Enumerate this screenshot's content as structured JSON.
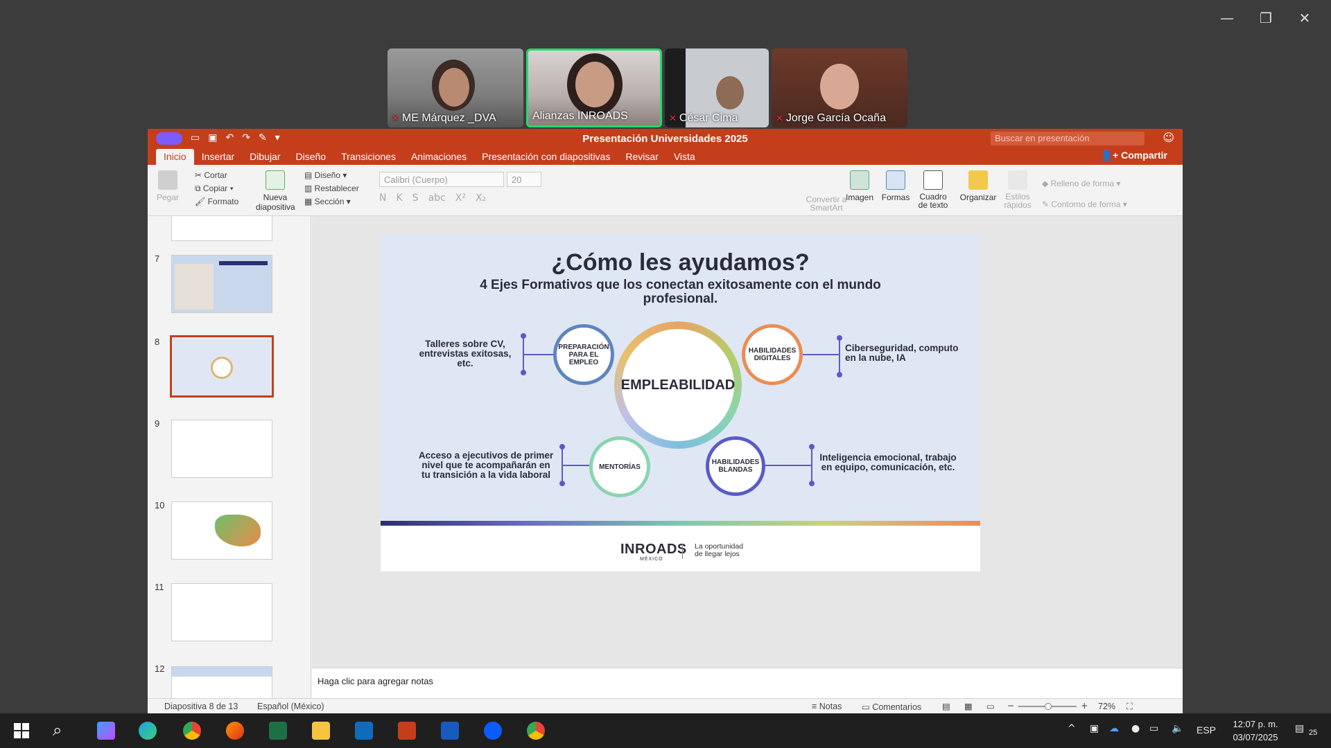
{
  "window_controls": {
    "minimize": "—",
    "restore": "❐",
    "close": "✕"
  },
  "participants": [
    {
      "name": "ME Márquez _DVA"
    },
    {
      "name": "Alianzas INROADS"
    },
    {
      "name": "César Cima"
    },
    {
      "name": "Jorge García Ocaña"
    }
  ],
  "ppt": {
    "title": "Presentación Universidades 2025",
    "search_placeholder": "Buscar en presentación",
    "tabs": [
      "Inicio",
      "Insertar",
      "Dibujar",
      "Diseño",
      "Transiciones",
      "Animaciones",
      "Presentación con diapositivas",
      "Revisar",
      "Vista"
    ],
    "share": "Compartir",
    "ribbon": {
      "paste": "Pegar",
      "cut": "Cortar",
      "copy": "Copiar",
      "format": "Formato",
      "new_slide": "Nueva diapositiva",
      "layout": "Diseño",
      "reset": "Restablecer",
      "section": "Sección",
      "font": "Calibri (Cuerpo)",
      "size": "20",
      "convert_smartart": "Convertir a SmartArt",
      "image": "Imagen",
      "shapes": "Formas",
      "textbox": "Cuadro de texto",
      "arrange": "Organizar",
      "quick_styles": "Estilos rápidos",
      "shape_fill": "Relleno de forma",
      "shape_outline": "Contorno de forma"
    },
    "thumbnails": [
      "7",
      "8",
      "9",
      "10",
      "11",
      "12"
    ],
    "slide": {
      "title": "¿Cómo les ayudamos?",
      "subtitle": "4 Ejes Formativos que los conectan exitosamente con el mundo profesional.",
      "center": "EMPLEABILIDAD",
      "c1": "PREPARACIÓN PARA EL EMPLEO",
      "c2": "HABILIDADES DIGITALES",
      "c3": "MENTORÍAS",
      "c4": "HABILIDADES BLANDAS",
      "t1": "Talleres sobre CV, entrevistas exitosas, etc.",
      "t2": "Ciberseguridad, computo en la nube, IA",
      "t3": "Acceso a ejecutivos de primer nivel que te acompañarán en tu transición a la vida laboral",
      "t4": "Inteligencia emocional, trabajo en equipo, comunicación, etc.",
      "logo": "INROADS",
      "logo_sub": "MÉXICO",
      "tagline": "La oportunidad de llegar lejos"
    },
    "notes_placeholder": "Haga clic para agregar notas",
    "status": {
      "slide_of": "Diapositiva 8 de 13",
      "language": "Español (México)",
      "notes": "Notas",
      "comments": "Comentarios",
      "zoom": "72%"
    }
  },
  "taskbar": {
    "lang": "ESP",
    "time": "12:07 p. m.",
    "date": "03/07/2025",
    "notif": "25"
  }
}
